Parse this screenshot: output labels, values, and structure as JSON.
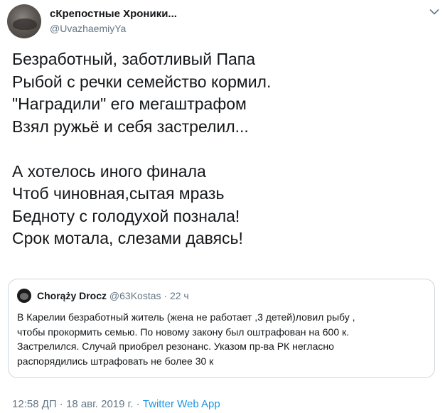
{
  "author": {
    "name": "сКрепостные Хроники...",
    "handle": "@UvazhaemiyYa",
    "avatar_icon": "profile-photo"
  },
  "menu": {
    "icon": "chevron-down-icon"
  },
  "tweet": {
    "lines": [
      "Безработный, заботливый Папа",
      "Рыбой с речки семейство кормил.",
      "\"Наградили\" его мегаштрафом",
      "Взял ружьё и себя застрелил...",
      "А хотелось иного финала",
      "Чтоб чиновная,сытая мразь",
      "Бедноту с голодухой познала!",
      "Срок мотала, слезами давясь!"
    ]
  },
  "quoted": {
    "name": "Chorąży Drocz",
    "handle": "@63Kostas",
    "separator": "·",
    "time": "22 ч",
    "lines": [
      "В Карелии безработный житель (жена не работает ,3 детей)ловил рыбу ,",
      "чтобы прокормить семью. По новому закону был оштрафован на 600 к.",
      "Застрелился. Случай приобрел резонанс. Указом пр-ва РК негласно",
      "распорядились штрафовать не более 30 к"
    ]
  },
  "footer": {
    "meta": "12:58 ДП · 18 авг. 2019 г. · ",
    "app": "Twitter Web App"
  },
  "colors": {
    "text": "#14171a",
    "secondary": "#657786",
    "link": "#1b95e0",
    "border": "#ccd6dd"
  }
}
